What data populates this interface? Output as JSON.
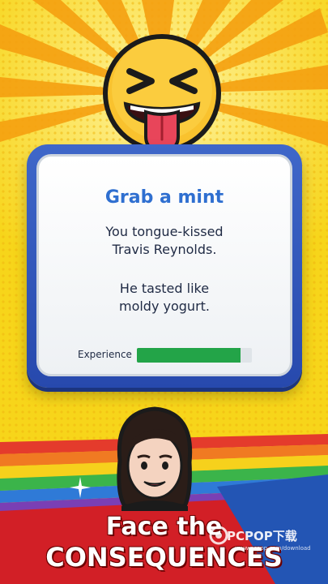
{
  "card": {
    "title": "Grab a mint",
    "line1a": "You tongue-kissed",
    "line1b": "Travis Reynolds.",
    "line2a": "He tasted like",
    "line2b": "moldy yogurt.",
    "experience_label": "Experience",
    "experience_level": 0.9
  },
  "banner": {
    "line1": "Face the",
    "line2": "CONSEQUENCES"
  },
  "watermark": {
    "text": "PCPOP下载",
    "sub": "www.pcpop.com/download"
  },
  "colors": {
    "background": "#f7d51a",
    "card_border": "#2f56bd",
    "title": "#2f6fd0",
    "experience_fill": "#23a448",
    "banner_red": "#d21f26"
  },
  "icons": [
    "squinting-tongue-face-emoji",
    "woman-avatar",
    "sparkle-icon"
  ]
}
